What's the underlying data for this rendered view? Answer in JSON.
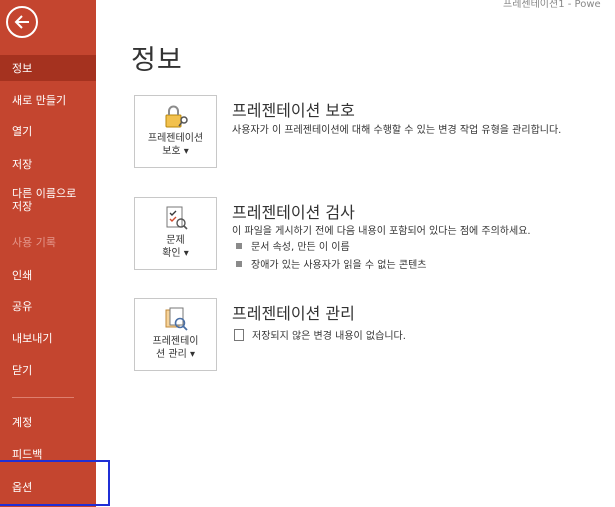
{
  "window": {
    "title_fragment": "프레젠테이션1 - Powe"
  },
  "sidebar": {
    "items": [
      {
        "label": "정보"
      },
      {
        "label": "새로 만들기"
      },
      {
        "label": "열기"
      },
      {
        "label": "저장"
      },
      {
        "label": "다른 이름으로 저장"
      },
      {
        "label": "사용 기록"
      },
      {
        "label": "인쇄"
      },
      {
        "label": "공유"
      },
      {
        "label": "내보내기"
      },
      {
        "label": "닫기"
      },
      {
        "label": "계정"
      },
      {
        "label": "피드백"
      },
      {
        "label": "옵션"
      }
    ]
  },
  "main": {
    "title": "정보",
    "sections": [
      {
        "tile_label": "프레젠테이션\n보호 ▾",
        "heading": "프레젠테이션 보호",
        "description": "사용자가 이 프레젠테이션에 대해 수행할 수 있는 변경 작업 유형을 관리합니다."
      },
      {
        "tile_label": "문제\n확인 ▾",
        "heading": "프레젠테이션 검사",
        "description": "이 파일을 게시하기 전에 다음 내용이 포함되어 있다는 점에 주의하세요.",
        "bullets": [
          "문서 속성, 만든 이 이름",
          "장애가 있는 사용자가 읽을 수 없는 콘텐츠"
        ]
      },
      {
        "tile_label": "프레젠테이\n션 관리 ▾",
        "heading": "프레젠테이션 관리",
        "note": "저장되지 않은 변경 내용이 없습니다."
      }
    ]
  },
  "colors": {
    "sidebar": "#c4452f",
    "sidebar_active": "#a5321f",
    "highlight_box": "#1f2fd6"
  }
}
